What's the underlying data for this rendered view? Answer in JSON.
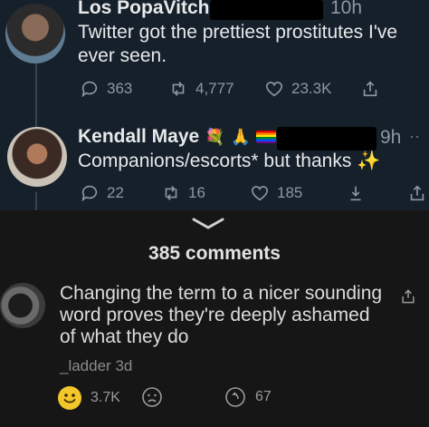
{
  "tweets": [
    {
      "name": "Los PopaVitch",
      "time": "10h",
      "text": "Twitter got the prettiest prostitutes I've ever seen.",
      "replies": "363",
      "retweets": "4,777",
      "likes": "23.3K"
    },
    {
      "name": "Kendall Maye",
      "name_emojis": "💐🙏🏳️‍🌈",
      "time": "9h",
      "text": "Companions/escorts* but thanks ✨",
      "replies": "22",
      "retweets": "16",
      "likes": "185"
    }
  ],
  "comments_section": {
    "count_label": "385 comments",
    "comment": {
      "text": "Changing the term to a nicer sounding word proves they're deeply ashamed of what they do",
      "author": "_ladder",
      "age": "3d",
      "upvotes": "3.7K",
      "replies": "67"
    }
  },
  "colors": {
    "twitter_bg": "#15202b",
    "reddit_bg": "#161616",
    "upvote_smiley": "#f3c72b",
    "muted_text": "#8b98a5"
  }
}
